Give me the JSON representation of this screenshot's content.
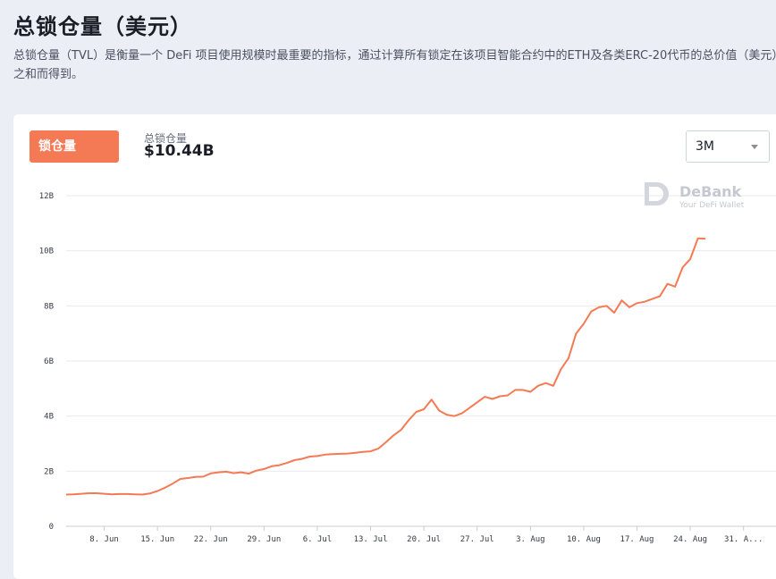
{
  "page": {
    "title": "总锁仓量（美元）",
    "description": "总锁仓量（TVL）是衡量一个 DeFi 项目使用规模时最重要的指标，通过计算所有锁定在该项目智能合约中的ETH及各类ERC-20代币的总价值（美元）之和而得到。"
  },
  "card": {
    "tab_label": "锁仓量",
    "tvl_label": "总锁仓量",
    "tvl_value": "$10.44B",
    "period": "3M"
  },
  "watermark": {
    "title": "DeBank",
    "subtitle": "Your DeFi Wallet"
  },
  "colors": {
    "line": "#f47a55",
    "grid": "#e8eaee",
    "accent": "#f47a55"
  },
  "chart_data": {
    "type": "line",
    "title": "",
    "xlabel": "",
    "ylabel": "",
    "ylim": [
      0,
      12
    ],
    "y_ticks": [
      0,
      2,
      4,
      6,
      8,
      10,
      12
    ],
    "y_tick_labels": [
      "0",
      "2B",
      "4B",
      "6B",
      "8B",
      "10B",
      "12B"
    ],
    "x_tick_labels": [
      "8. Jun",
      "15. Jun",
      "22. Jun",
      "29. Jun",
      "6. Jul",
      "13. Jul",
      "20. Jul",
      "27. Jul",
      "3. Aug",
      "10. Aug",
      "17. Aug",
      "24. Aug",
      "31. A..."
    ],
    "x_range_days": [
      0,
      91.5
    ],
    "x_tick_days": [
      5,
      12,
      19,
      26,
      33,
      40,
      47,
      54,
      61,
      68,
      75,
      82,
      89
    ],
    "grid": true,
    "legend": "none",
    "series": [
      {
        "unit": "B USD",
        "x_days": [
          0,
          1,
          2,
          3,
          4,
          5,
          6,
          7,
          8,
          9,
          10,
          11,
          12,
          13,
          14,
          15,
          16,
          17,
          18,
          19,
          20,
          21,
          22,
          23,
          24,
          25,
          26,
          27,
          28,
          29,
          30,
          31,
          32,
          33,
          34,
          35,
          36,
          37,
          38,
          39,
          40,
          41,
          42,
          43,
          44,
          45,
          46,
          47,
          48,
          49,
          50,
          51,
          52,
          52.5,
          53,
          54,
          55,
          56,
          57,
          58,
          59,
          60,
          61,
          62,
          63,
          64,
          65,
          66,
          67,
          68,
          69,
          70,
          71,
          72,
          73,
          74,
          75,
          76,
          77,
          78,
          79,
          80,
          81,
          82,
          83,
          84,
          85,
          86,
          87,
          88,
          89,
          90,
          91
        ],
        "values": [
          1.15,
          1.16,
          1.18,
          1.2,
          1.2,
          1.18,
          1.16,
          1.17,
          1.17,
          1.16,
          1.15,
          1.19,
          1.28,
          1.4,
          1.55,
          1.72,
          1.75,
          1.79,
          1.8,
          1.92,
          1.96,
          1.98,
          1.93,
          1.96,
          1.91,
          2.02,
          2.08,
          2.18,
          2.22,
          2.3,
          2.4,
          2.45,
          2.53,
          2.55,
          2.6,
          2.62,
          2.63,
          2.64,
          2.67,
          2.7,
          2.72,
          2.82,
          3.05,
          3.3,
          3.5,
          3.85,
          4.15,
          4.25,
          4.6,
          4.2,
          4.05,
          4.0,
          4.1,
          4.2,
          4.3,
          4.5,
          4.7,
          4.62,
          4.72,
          4.75,
          4.95,
          4.95,
          4.88,
          5.1,
          5.2,
          5.1,
          5.7,
          6.1,
          7.0,
          7.35,
          7.8,
          7.95,
          8.0,
          7.75,
          8.2,
          7.95,
          8.1,
          8.15,
          8.25,
          8.35,
          8.8,
          8.7,
          9.4,
          9.7,
          10.45,
          10.44
        ]
      }
    ]
  }
}
